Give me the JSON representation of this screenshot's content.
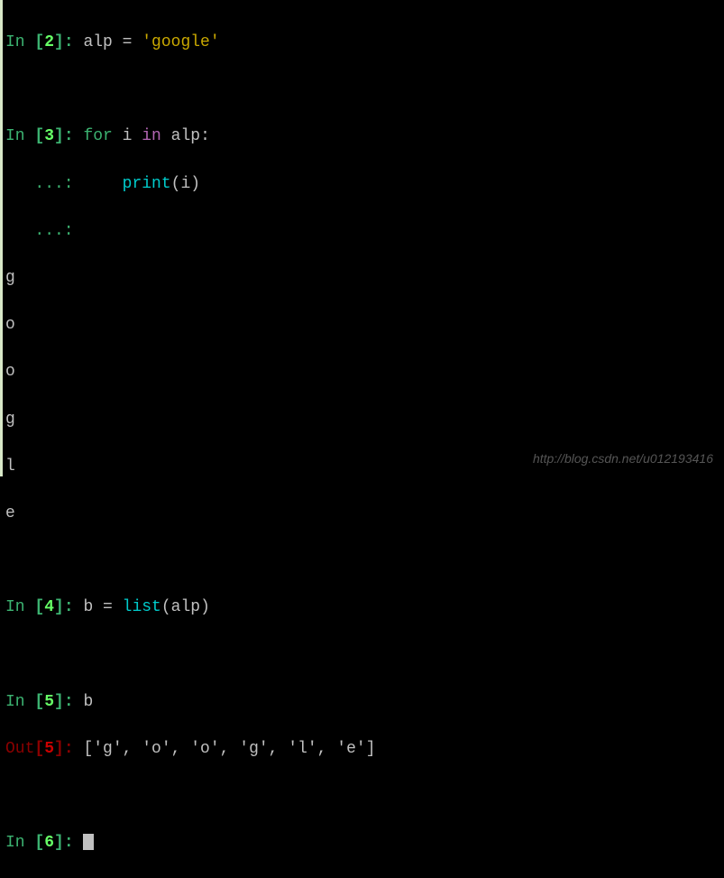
{
  "cells": {
    "c2": {
      "in_label": "In ",
      "num": "2",
      "code_var": "alp",
      "code_eq": " = ",
      "code_str": "'google'"
    },
    "c3": {
      "in_label": "In ",
      "num": "3",
      "for_kw": "for",
      "iter": " i ",
      "in_kw": "in",
      "coll": " alp:",
      "cont1": "   ...: ",
      "indent": "    ",
      "print_fn": "print",
      "print_arg": "(i)",
      "cont2": "   ...: ",
      "output": [
        "g",
        "o",
        "o",
        "g",
        "l",
        "e"
      ]
    },
    "c4": {
      "in_label": "In ",
      "num": "4",
      "var": "b",
      "eq": " = ",
      "fn": "list",
      "arg": "(alp)"
    },
    "c5": {
      "in_label": "In ",
      "num": "5",
      "code": "b",
      "out_label": "Out",
      "out_val": "['g', 'o', 'o', 'g', 'l', 'e']"
    },
    "c6": {
      "in_label": "In ",
      "num": "6"
    }
  },
  "watermark": "http://blog.csdn.net/u012193416"
}
